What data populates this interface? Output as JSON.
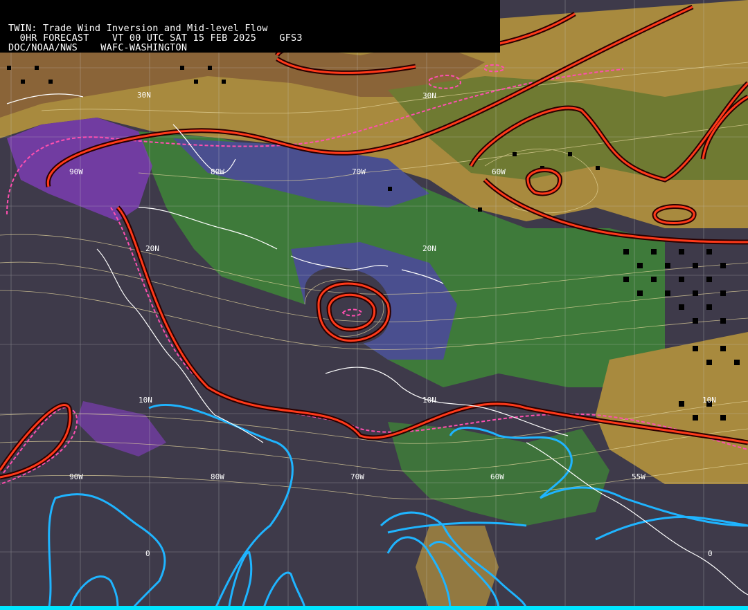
{
  "header": {
    "line1": "TWIN: Trade Wind Inversion and Mid-level Flow",
    "line2": "  0HR FORECAST    VT 00 UTC SAT 15 FEB 2025    GFS3",
    "line3": "DOC/NOAA/NWS    WAFC-WASHINGTON"
  },
  "grid_labels": [
    {
      "id": "lbl-30n-left",
      "text": "30N"
    },
    {
      "id": "lbl-30n-right",
      "text": "30N"
    },
    {
      "id": "lbl-90w-top",
      "text": "90W"
    },
    {
      "id": "lbl-80w-top",
      "text": "80W"
    },
    {
      "id": "lbl-70w-top",
      "text": "70W"
    },
    {
      "id": "lbl-60w-top",
      "text": "60W"
    },
    {
      "id": "lbl-20n-left",
      "text": "20N"
    },
    {
      "id": "lbl-20n-right",
      "text": "20N"
    },
    {
      "id": "lbl-10n-left",
      "text": "10N"
    },
    {
      "id": "lbl-10n-mid",
      "text": "10N"
    },
    {
      "id": "lbl-10n-right",
      "text": "10N"
    },
    {
      "id": "lbl-90w-bot",
      "text": "90W"
    },
    {
      "id": "lbl-80w-bot",
      "text": "80W"
    },
    {
      "id": "lbl-70w-bot",
      "text": "70W"
    },
    {
      "id": "lbl-60w-bot",
      "text": "60W"
    },
    {
      "id": "lbl-55w-bot",
      "text": "55W"
    },
    {
      "id": "lbl-0-left",
      "text": "0"
    },
    {
      "id": "lbl-0-right",
      "text": "0"
    }
  ],
  "colors": {
    "background": "#3e3a4a",
    "dark_purple": "#3e3a4a",
    "violet": "#7a3db0",
    "slate_blue": "#4a4f8f",
    "green": "#3e7a3a",
    "olive": "#6f7a32",
    "tan": "#a88a3e",
    "brown": "#8a6438",
    "inversion_line_outer": "#2a0000",
    "inversion_line_inner": "#ff3a1a",
    "dashed_pink": "#ff4fb0",
    "cyan_line": "#1fb4ff",
    "coastline": "#ffffff",
    "streamline": "#e8d9a0"
  }
}
